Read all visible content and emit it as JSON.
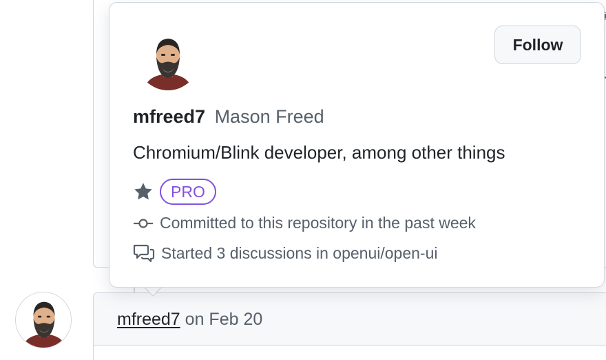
{
  "hovercard": {
    "login": "mfreed7",
    "full_name": "Mason Freed",
    "bio": "Chromium/Blink developer, among other things",
    "follow_label": "Follow",
    "badge_label": "PRO",
    "activity": [
      {
        "icon": "git-commit-icon",
        "text": "Committed to this repository in the past week"
      },
      {
        "icon": "comment-discussion-icon",
        "text": "Started 3 discussions in openui/open-ui"
      }
    ]
  },
  "comment": {
    "author": "mfreed7",
    "date_text": "on Feb 20"
  },
  "colors": {
    "accent_pro": "#8250df",
    "border": "#d0d7de",
    "muted_text": "#57606a",
    "header_bg": "#f6f8fa"
  }
}
